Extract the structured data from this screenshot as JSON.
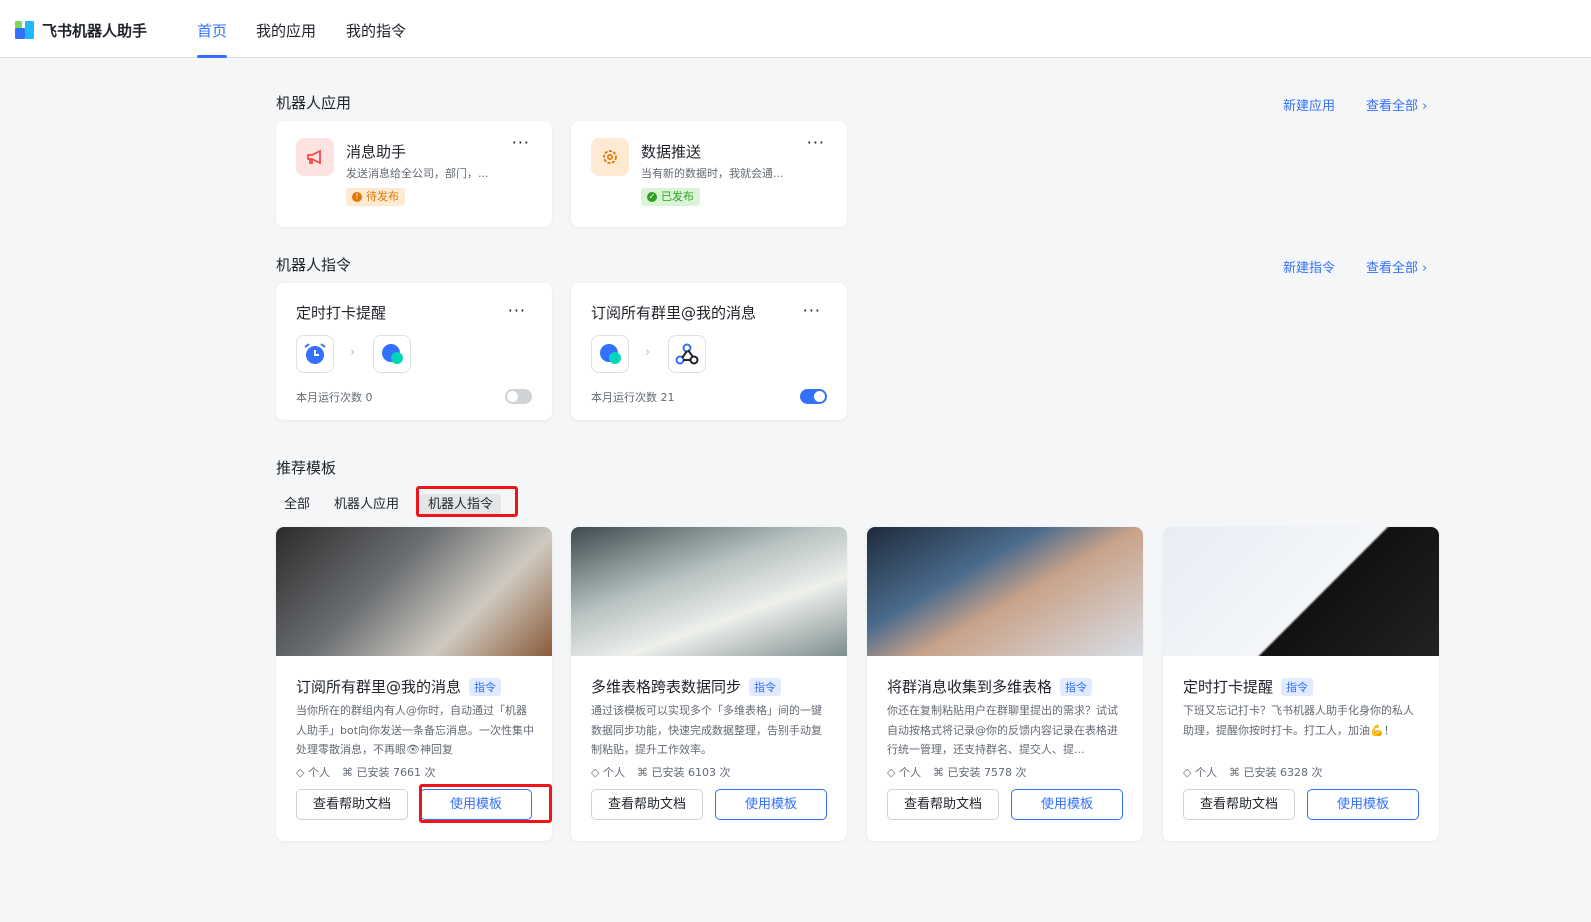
{
  "header": {
    "brand": "飞书机器人助手",
    "nav": [
      "首页",
      "我的应用",
      "我的指令"
    ],
    "active": "首页"
  },
  "apps": {
    "title": "机器人应用",
    "new": "新建应用",
    "view_all": "查看全部",
    "items": [
      {
        "name": "消息助手",
        "desc": "发送消息给全公司，部门，...",
        "status": "待发布",
        "icon": "megaphone-icon",
        "more": "···"
      },
      {
        "name": "数据推送",
        "desc": "当有新的数据时，我就会通...",
        "status": "已发布",
        "icon": "gear-icon",
        "more": "···"
      }
    ]
  },
  "commands": {
    "title": "机器人指令",
    "new": "新建指令",
    "view_all": "查看全部",
    "items": [
      {
        "name": "定时打卡提醒",
        "runs": "本月运行次数 0",
        "enabled": false,
        "more": "···",
        "icons": [
          "alarm-clock-icon",
          "chat-bubble-icon"
        ]
      },
      {
        "name": "订阅所有群里@我的消息",
        "runs": "本月运行次数 21",
        "enabled": true,
        "more": "···",
        "icons": [
          "chat-bubble-icon",
          "webhook-icon"
        ]
      }
    ]
  },
  "templates": {
    "title": "推荐模板",
    "tabs": [
      "全部",
      "机器人应用",
      "机器人指令"
    ],
    "selected_tab": "机器人指令",
    "items": [
      {
        "title": "订阅所有群里@我的消息",
        "tag": "指令",
        "desc": "当你所在的群组内有人@你时，自动通过「机器人助手」bot向你发送一条备忘消息。一次性集中处理零散消息，不再眼👁神回复",
        "scope": "个人",
        "installs": "已安装 7661 次",
        "help": "查看帮助文档",
        "use": "使用模板"
      },
      {
        "title": "多维表格跨表数据同步",
        "tag": "指令",
        "desc": "通过该模板可以实现多个「多维表格」间的一键数据同步功能，快速完成数据整理，告别手动复制粘贴，提升工作效率。",
        "scope": "个人",
        "installs": "已安装 6103 次",
        "help": "查看帮助文档",
        "use": "使用模板"
      },
      {
        "title": "将群消息收集到多维表格",
        "tag": "指令",
        "desc": "你还在复制粘贴用户在群聊里提出的需求？试试自动按格式将记录@你的反馈内容记录在表格进行统一管理，还支持群名、提交人、提...",
        "scope": "个人",
        "installs": "已安装 7578 次",
        "help": "查看帮助文档",
        "use": "使用模板"
      },
      {
        "title": "定时打卡提醒",
        "tag": "指令",
        "desc": "下班又忘记打卡？飞书机器人助手化身你的私人助理，提醒你按时打卡。打工人，加油💪！",
        "scope": "个人",
        "installs": "已安装 6328 次",
        "help": "查看帮助文档",
        "use": "使用模板"
      }
    ]
  },
  "colors": {
    "accent": "#3370ff",
    "highlight": "#f0141a"
  }
}
